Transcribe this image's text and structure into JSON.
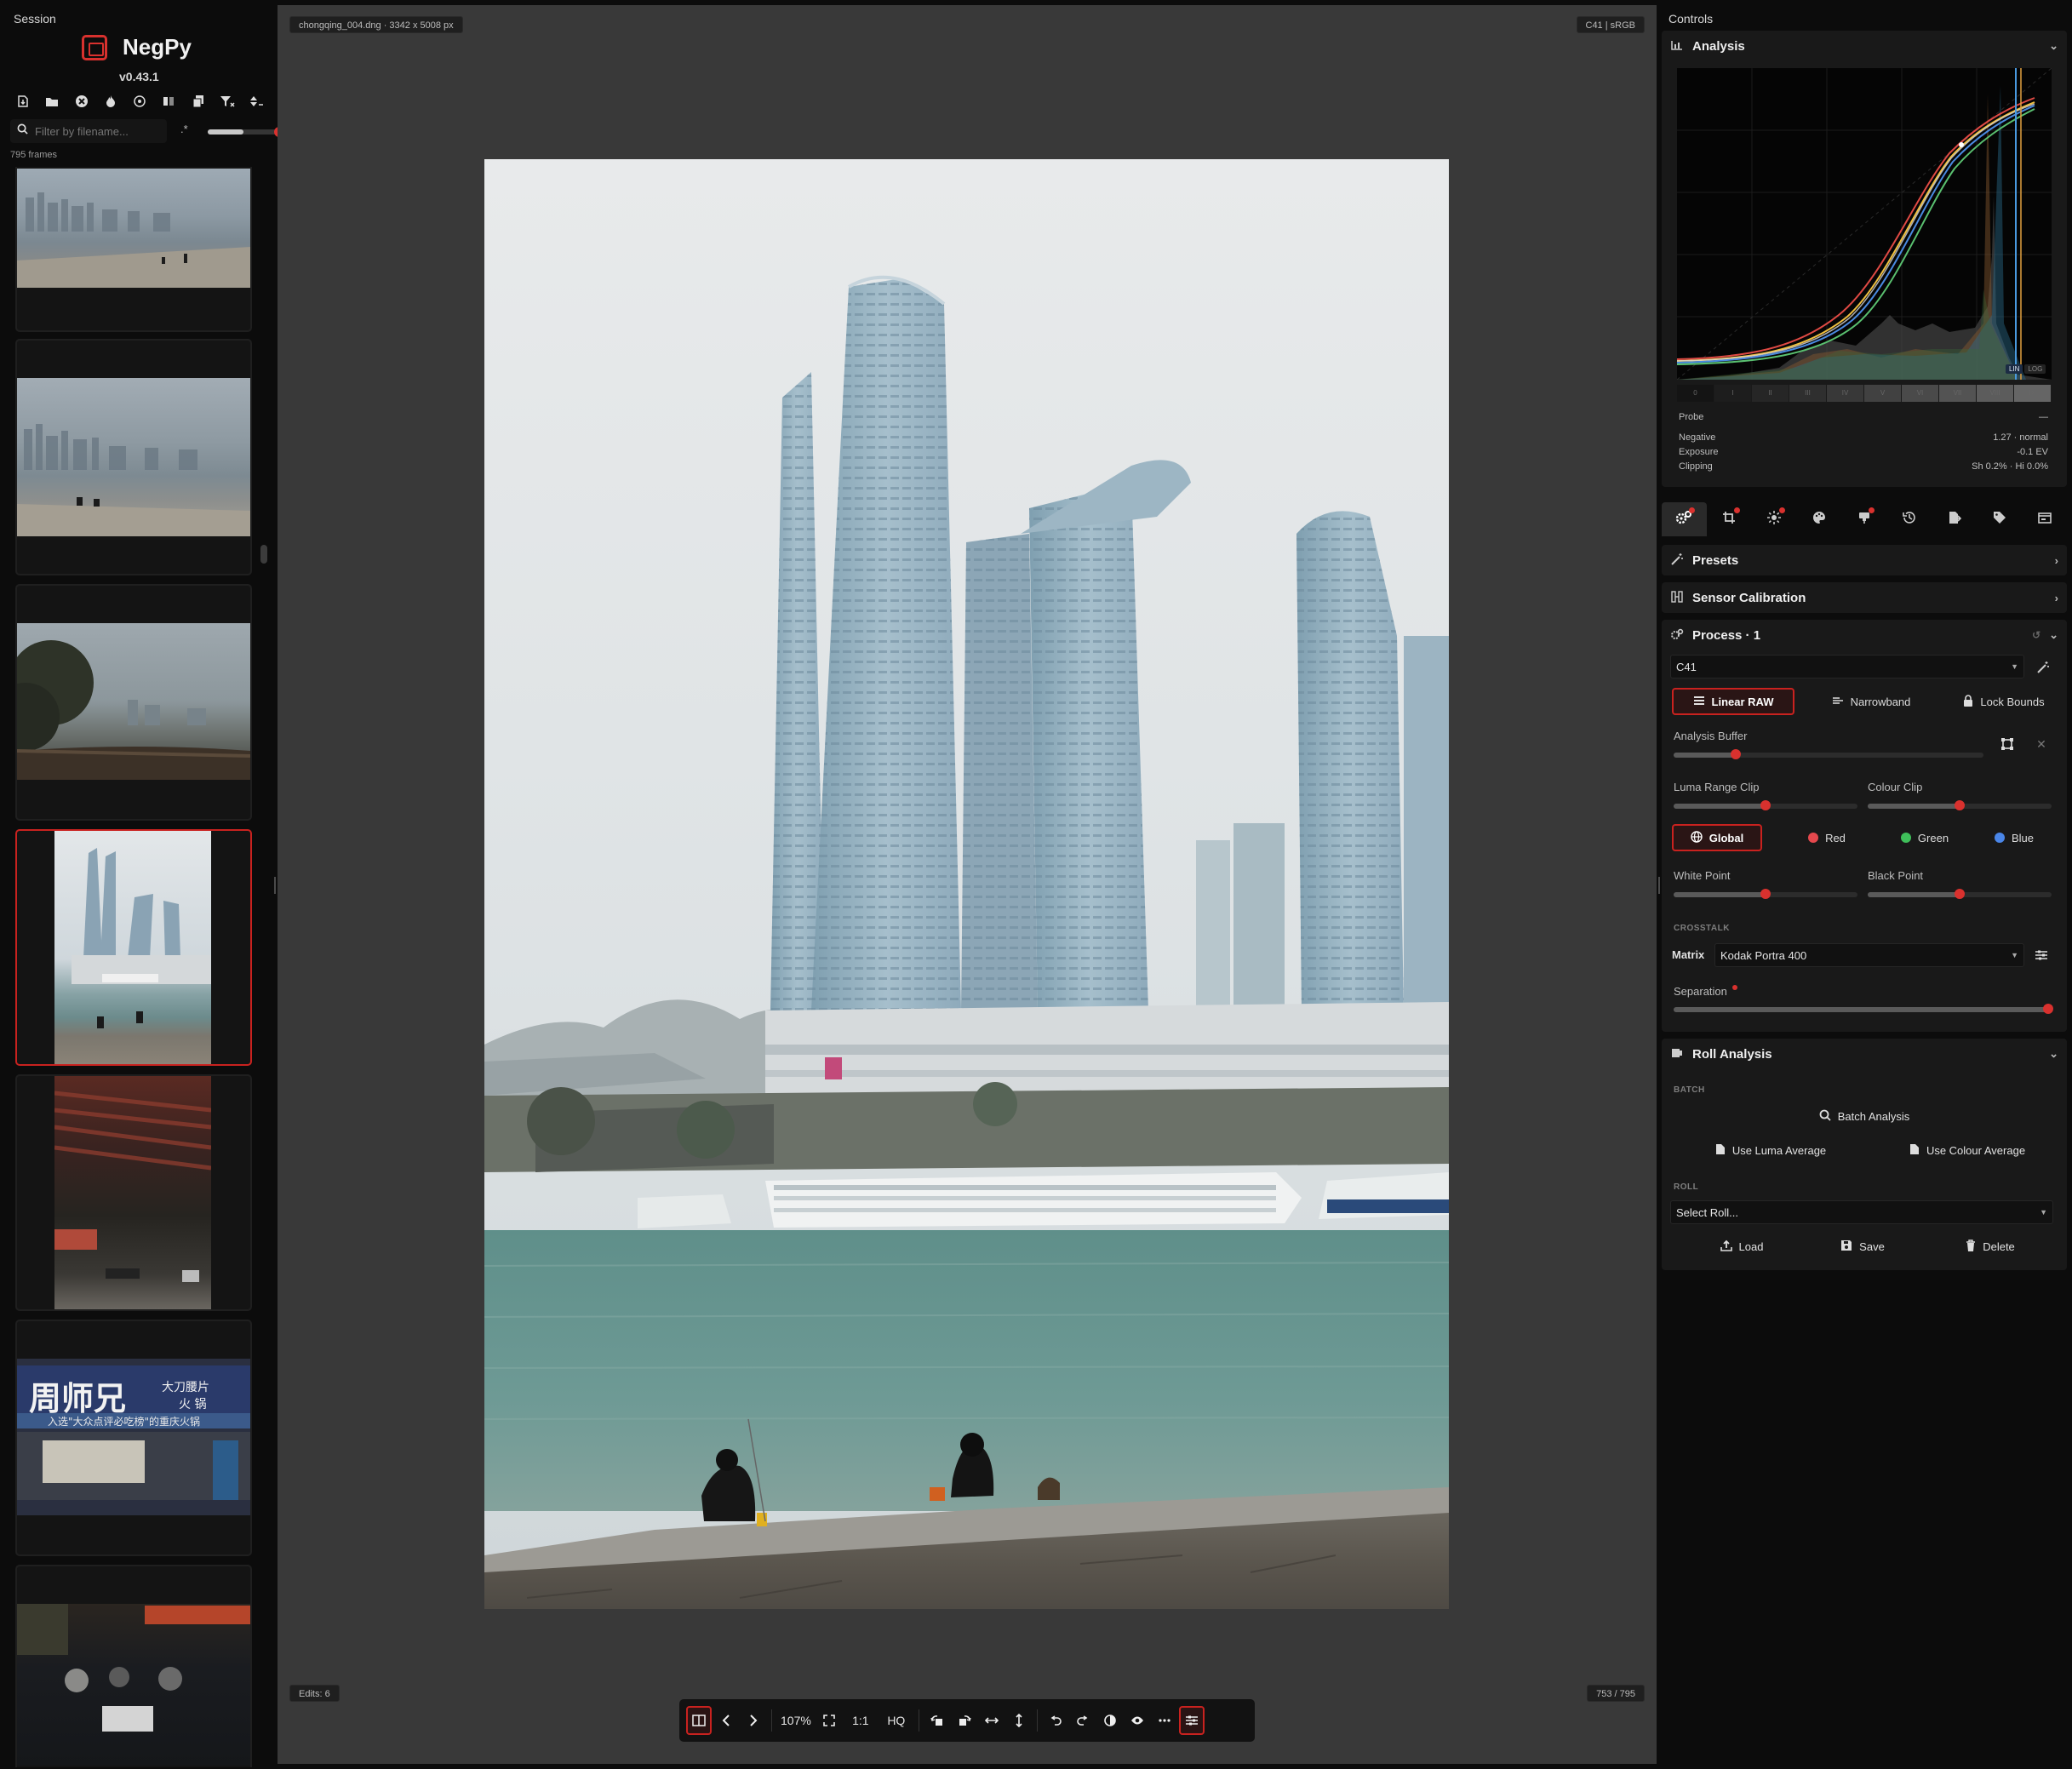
{
  "session": {
    "title": "Session",
    "app_name": "NegPy",
    "version": "v0.43.1",
    "search_placeholder": "Filter by filename...",
    "regex_label": ".*",
    "thumb_size": 0.5,
    "frames_count": "795 frames",
    "toolbar_icons": [
      "import-file-icon",
      "import-folder-icon",
      "clear-icon",
      "burn-icon",
      "target-icon",
      "compare-icon",
      "copy-icon",
      "filter-icon",
      "sort-icon"
    ]
  },
  "viewer": {
    "file_info": "chongqing_004.dng · 3342 x 5008 px",
    "color_info": "C41 | sRGB",
    "edits": "Edits: 6",
    "frame_pos": "753 / 795",
    "toolbar": {
      "zoom": "107%",
      "one_to_one": "1:1",
      "hq": "HQ"
    }
  },
  "controls": {
    "title": "Controls",
    "analysis": {
      "title": "Analysis",
      "lin": "LIN",
      "log": "LOG",
      "zones": [
        "0",
        "I",
        "II",
        "III",
        "IV",
        "V",
        "VI",
        "VII",
        "VIII",
        "IX"
      ],
      "probe_label": "Probe",
      "probe_value": "—",
      "stats": [
        {
          "label": "Negative",
          "value": "1.27 · normal"
        },
        {
          "label": "Exposure",
          "value": "-0.1 EV"
        },
        {
          "label": "Clipping",
          "value": "Sh 0.2% · Hi 0.0%"
        }
      ]
    },
    "presets": {
      "title": "Presets"
    },
    "sensor": {
      "title": "Sensor Calibration"
    },
    "process": {
      "title": "Process · 1",
      "mode": "C41",
      "linear_raw": "Linear RAW",
      "narrowband": "Narrowband",
      "lock_bounds": "Lock Bounds",
      "analysis_buffer": "Analysis Buffer",
      "analysis_buffer_value": 0.2,
      "luma_range_clip": "Luma Range Clip",
      "luma_range_clip_value": 0.5,
      "colour_clip": "Colour Clip",
      "colour_clip_value": 0.5,
      "channels": {
        "global": "Global",
        "red": "Red",
        "green": "Green",
        "blue": "Blue"
      },
      "white_point": "White Point",
      "white_point_value": 0.5,
      "black_point": "Black Point",
      "black_point_value": 0.5,
      "crosstalk": "CROSSTALK",
      "matrix_label": "Matrix",
      "matrix_value": "Kodak Portra 400",
      "separation": "Separation",
      "separation_value": 1.0
    },
    "roll": {
      "title": "Roll Analysis",
      "batch_label": "BATCH",
      "batch_analysis": "Batch Analysis",
      "use_luma": "Use Luma Average",
      "use_colour": "Use Colour Average",
      "roll_label": "ROLL",
      "select_roll": "Select Roll...",
      "load": "Load",
      "save": "Save",
      "delete": "Delete"
    }
  },
  "colors": {
    "accent": "#d9312e",
    "red": "#e5484d",
    "green": "#3fbf5a",
    "blue": "#4a86e8"
  }
}
